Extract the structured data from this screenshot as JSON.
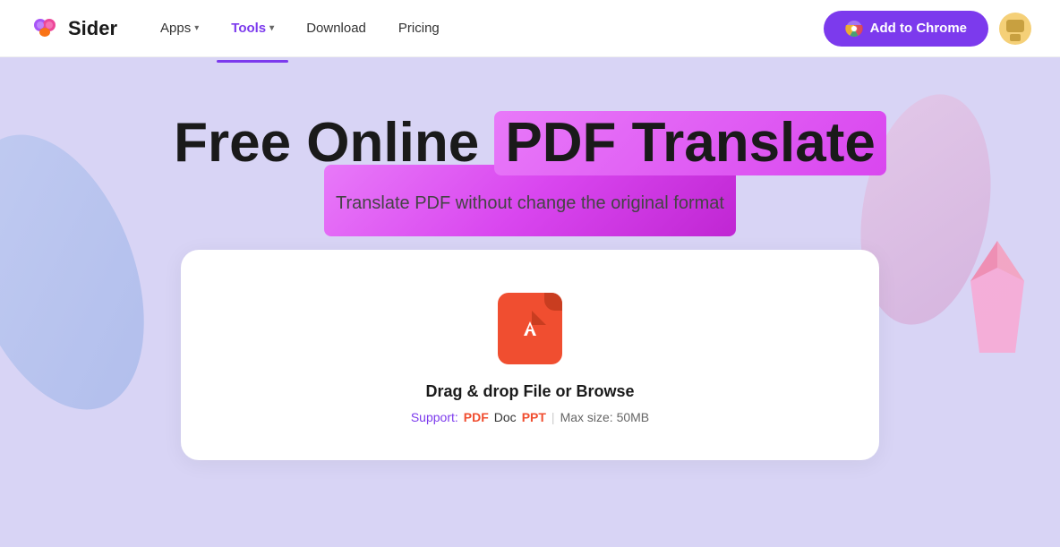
{
  "navbar": {
    "logo_text": "Sider",
    "nav_items": [
      {
        "label": "Apps",
        "active": false,
        "has_chevron": true
      },
      {
        "label": "Tools",
        "active": true,
        "has_chevron": true
      },
      {
        "label": "Download",
        "active": false,
        "has_chevron": false
      },
      {
        "label": "Pricing",
        "active": false,
        "has_chevron": false
      }
    ],
    "cta_button": "Add to Chrome"
  },
  "hero": {
    "title_part1": "Free Online ",
    "title_highlight": "PDF Translate",
    "subtitle": "Translate PDF without change the original format",
    "upload": {
      "drag_text": "Drag & drop File or Browse",
      "support_label": "Support:",
      "type_pdf": "PDF",
      "type_doc": "Doc",
      "type_ppt": "PPT",
      "divider": "|",
      "max_size": "Max size: 50MB"
    }
  }
}
